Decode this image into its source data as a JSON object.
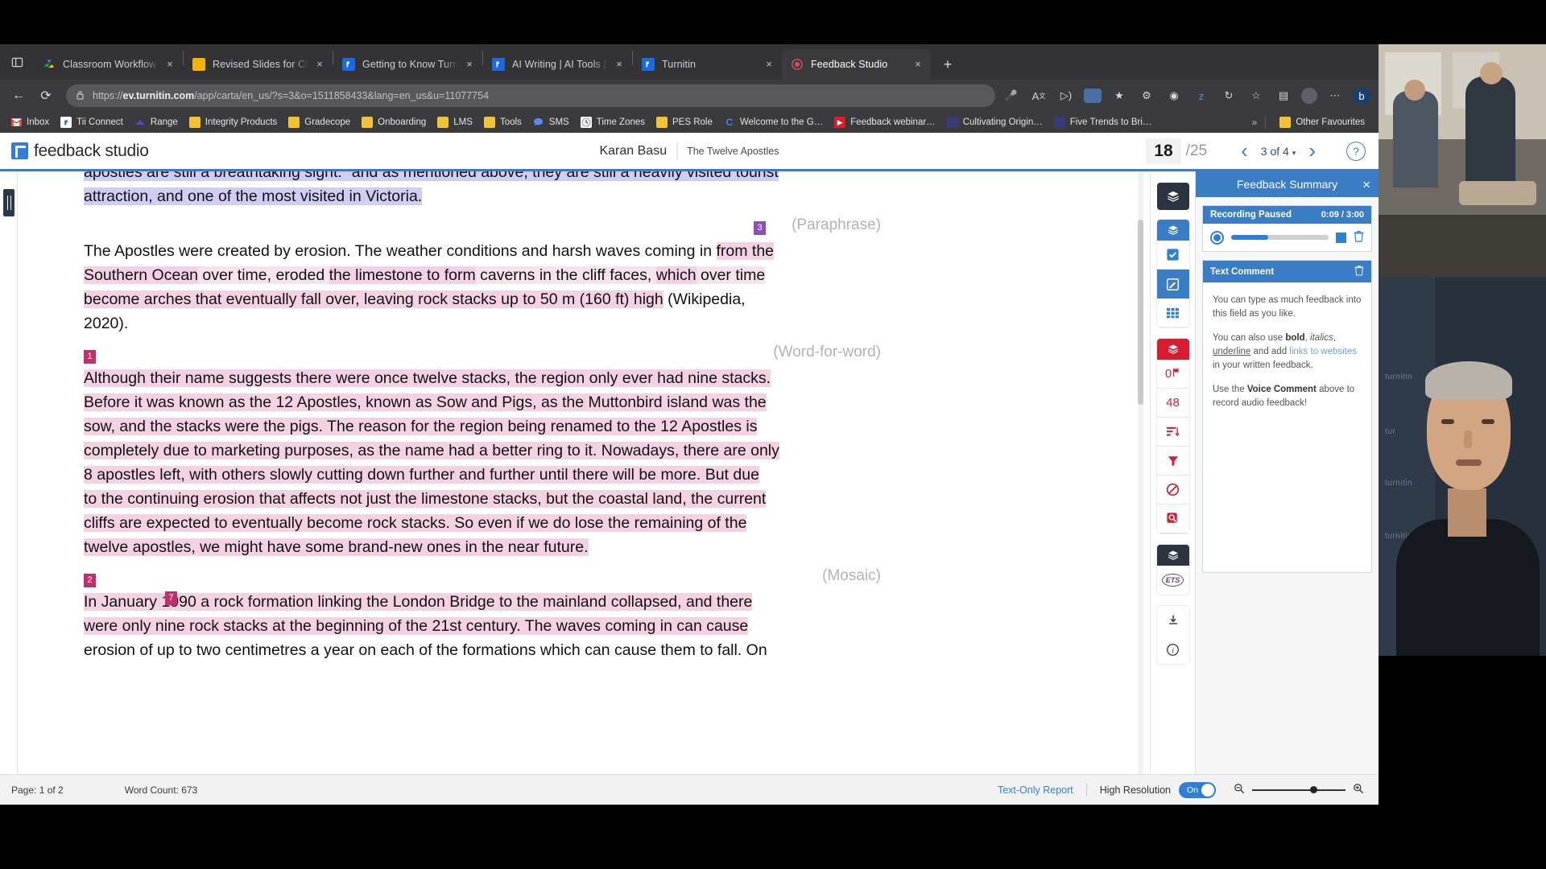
{
  "browser": {
    "tabs": [
      {
        "title": "Classroom Workflow - Google",
        "favicon": "google-drive-icon",
        "active": false
      },
      {
        "title": "Revised Slides for Classroom W",
        "favicon": "google-slides-icon",
        "active": false
      },
      {
        "title": "Getting to Know Turnitin Feedb",
        "favicon": "turnitin-icon",
        "active": false
      },
      {
        "title": "AI Writing | AI Tools | Turnitin",
        "favicon": "turnitin-icon",
        "active": false
      },
      {
        "title": "Turnitin",
        "favicon": "turnitin-icon",
        "active": false
      },
      {
        "title": "Feedback Studio",
        "favicon": "recording-icon",
        "active": true
      }
    ],
    "new_tab_label": "+",
    "close_label": "×",
    "nav": {
      "back": "←",
      "reload": "⟳"
    },
    "address": {
      "lock_icon": "lock-icon",
      "url_domain": "ev.turnitin.com",
      "url_prefix": "https://",
      "url_path": "/app/carta/en_us/?s=3&o=1511858433&lang=en_us&u=11077754"
    },
    "omni_icons": [
      "microphone-icon",
      "translate-icon",
      "read-aloud-icon",
      "collections-icon",
      "split-screen-icon",
      "settings-icon",
      "shield-icon",
      "grammarly-icon",
      "extension-icon",
      "favorite-icon",
      "collections2-icon",
      "profile-icon",
      "more-icon",
      "copilot-icon"
    ],
    "bookmarks": [
      {
        "label": "Inbox",
        "icon": "gmail-icon"
      },
      {
        "label": "Tii Connect",
        "icon": "turnitin-icon"
      },
      {
        "label": "Range",
        "icon": "range-icon"
      },
      {
        "label": "Integrity Products",
        "icon": "folder-icon"
      },
      {
        "label": "Gradecope",
        "icon": "folder-icon"
      },
      {
        "label": "Onboarding",
        "icon": "folder-icon"
      },
      {
        "label": "LMS",
        "icon": "folder-icon"
      },
      {
        "label": "Tools",
        "icon": "folder-icon"
      },
      {
        "label": "SMS",
        "icon": "chat-icon"
      },
      {
        "label": "Time Zones",
        "icon": "clock-icon"
      },
      {
        "label": "PES Role",
        "icon": "folder-icon"
      },
      {
        "label": "Welcome to the G…",
        "icon": "c-icon"
      },
      {
        "label": "Feedback webinar…",
        "icon": "youtube-icon"
      },
      {
        "label": "Cultivating Origin…",
        "icon": "turnitin-icon"
      },
      {
        "label": "Five Trends to Bri…",
        "icon": "turnitin-icon"
      }
    ],
    "bookmarks_overflow": "»",
    "other_favourites": "Other Favourites"
  },
  "app": {
    "logo_text": "feedback studio",
    "student_name": "Karan Basu",
    "paper_title": "The Twelve Apostles",
    "grade": "18",
    "grade_total": "/25",
    "prev_arrow": "‹",
    "next_arrow": "›",
    "pager": "3 of 4",
    "pager_caret": "▾",
    "help": "?"
  },
  "document": {
    "para0_a": "apostles are still a breathtaking sight.” and as mentioned above, they are still a heavily visited tourist",
    "para0_b": "attraction, and one of the most visited in Victoria.",
    "tag_paraphrase": "(Paraphrase)",
    "marker3": "3",
    "para1_l1_plain": "The Apostles were created by erosion. The weather conditions and harsh waves coming in ",
    "para1_l1_hl": "from the",
    "para1_l2_hl1": "Southern Ocean",
    "para1_l2_plain1": " over time, eroded ",
    "para1_l2_hl2": "the limestone to form",
    "para1_l2_plain2": " caverns in the cliff faces, ",
    "para1_l2_hl3": "which",
    "para1_l2_plain3": " over time",
    "para1_l3_hl": "become arches that eventually fall over, leaving rock stacks up to 50 m (160 ft) high",
    "para1_l3_plain": " (Wikipedia,",
    "para1_l4": "2020).",
    "tag_word_for_word": "(Word-for-word)",
    "marker1": "1",
    "para2_l1": "Although their name suggests there were once twelve stacks, the region only ever had nine stacks.",
    "para2_l2": "Before it was known as the 12 Apostles, known as Sow and Pigs, as the Muttonbird island was the",
    "para2_l3": "sow, and the stacks were the pigs. The reason for the region being renamed to the 12 Apostles is",
    "para2_l4": "completely due to marketing purposes, as the name had a better ring to it. Nowadays, there are only",
    "para2_l5": "8 apostles left, with others slowly cutting down further and further until there will be more. But due",
    "para2_l6": "to the continuing erosion that affects not just the limestone stacks, but the coastal land, the current",
    "para2_l7": "cliffs are expected to eventually become rock stacks. So even if we do lose the remaining of the",
    "para2_l8": "twelve apostles, we might have some brand-new ones in the near future.",
    "tag_mosaic": "(Mosaic)",
    "marker2": "2",
    "marker7": "7",
    "para3_l1": "In January 1990 a rock formation linking the London Bridge to the mainland collapsed, and there",
    "para3_l2": "were only nine rock stacks at the beginning of the 21st century. The waves coming in can cause",
    "para3_l3": "erosion of up to two centimetres a year on each of the formations which can cause them to fall. On"
  },
  "iconrail": {
    "groups": [
      {
        "name": "layers-toggle",
        "items": [
          {
            "icon": "layers-icon",
            "label": ""
          }
        ]
      },
      {
        "name": "grading-tools",
        "items": [
          {
            "icon": "layers-icon",
            "label": ""
          },
          {
            "icon": "rubric-check-icon",
            "label": ""
          },
          {
            "icon": "quickmarks-pen-icon",
            "label": ""
          },
          {
            "icon": "grid-icon",
            "label": ""
          }
        ]
      },
      {
        "name": "similarity-tools",
        "items": [
          {
            "icon": "layers-icon",
            "label": ""
          },
          {
            "icon": "flag-icon",
            "label": "0"
          },
          {
            "icon": "similarity-score-icon",
            "label": "48"
          },
          {
            "icon": "sort-icon",
            "label": ""
          },
          {
            "icon": "filter-icon",
            "label": ""
          },
          {
            "icon": "exclude-icon",
            "label": ""
          },
          {
            "icon": "search-source-icon",
            "label": ""
          }
        ]
      },
      {
        "name": "ets-tools",
        "items": [
          {
            "icon": "layers-icon",
            "label": ""
          },
          {
            "icon": "ets-icon",
            "label": "ETS"
          }
        ]
      },
      {
        "name": "utility-tools",
        "items": [
          {
            "icon": "download-icon",
            "label": ""
          },
          {
            "icon": "info-icon",
            "label": "i"
          }
        ]
      }
    ]
  },
  "panel": {
    "title": "Feedback Summary",
    "close": "×",
    "recording": {
      "status": "Recording Paused",
      "time": "0:09 / 3:00",
      "record_icon": "record-icon",
      "stop_icon": "stop-icon",
      "delete_icon": "trash-icon",
      "progress_percent": 38
    },
    "text_comment": {
      "title": "Text Comment",
      "delete_icon": "trash-icon",
      "p1": "You can type as much feedback into this field as you like.",
      "p2_pre": "You can also use ",
      "p2_bold": "bold",
      "p2_mid1": ", ",
      "p2_italic": "italics",
      "p2_mid2": ", ",
      "p2_underline": "underline",
      "p2_mid3": " and add ",
      "p2_link": "links to websites",
      "p2_end": " in your written feedback.",
      "p3_pre": "Use the ",
      "p3_bold": "Voice Comment",
      "p3_end": " above to record audio feedback!"
    }
  },
  "status": {
    "page": "Page: 1 of 2",
    "word_count": "Word Count: 673",
    "text_only_report": "Text-Only Report",
    "high_resolution_label": "High Resolution",
    "toggle_state": "On",
    "zoom_out_icon": "zoom-out-icon",
    "zoom_in_icon": "zoom-in-icon"
  },
  "colors": {
    "accent_blue": "#3b7dc4",
    "similarity_red": "#d81b2e",
    "highlight_purple": "#cfcdf4",
    "highlight_pink": "#f4d2e4",
    "marker_pink": "#c0306c"
  }
}
